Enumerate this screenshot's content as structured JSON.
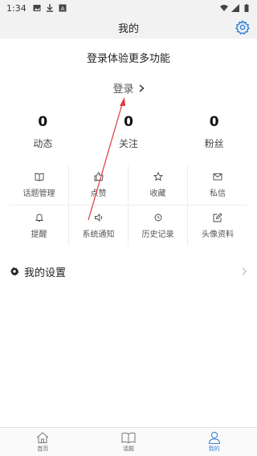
{
  "status_bar": {
    "time": "1:34"
  },
  "header": {
    "title": "我的"
  },
  "login": {
    "headline": "登录体验更多功能",
    "link_label": "登录"
  },
  "stats": [
    {
      "value": "0",
      "label": "动态"
    },
    {
      "value": "0",
      "label": "关注"
    },
    {
      "value": "0",
      "label": "粉丝"
    }
  ],
  "grid": [
    {
      "label": "话题管理",
      "icon": "book-icon"
    },
    {
      "label": "点赞",
      "icon": "thumbs-up-icon"
    },
    {
      "label": "收藏",
      "icon": "star-icon"
    },
    {
      "label": "私信",
      "icon": "mail-icon"
    },
    {
      "label": "提醒",
      "icon": "bell-icon"
    },
    {
      "label": "系统通知",
      "icon": "speaker-icon"
    },
    {
      "label": "历史记录",
      "icon": "clock-icon"
    },
    {
      "label": "头像资料",
      "icon": "edit-icon"
    }
  ],
  "settings": {
    "label": "我的设置"
  },
  "tabbar": [
    {
      "label": "首页",
      "icon": "home-icon",
      "active": false
    },
    {
      "label": "话题",
      "icon": "book-open-icon",
      "active": false
    },
    {
      "label": "我的",
      "icon": "person-icon",
      "active": true
    }
  ],
  "colors": {
    "accent": "#3a86d8",
    "annotation": "#e0383e",
    "header_bg": "#f2f2f2"
  }
}
